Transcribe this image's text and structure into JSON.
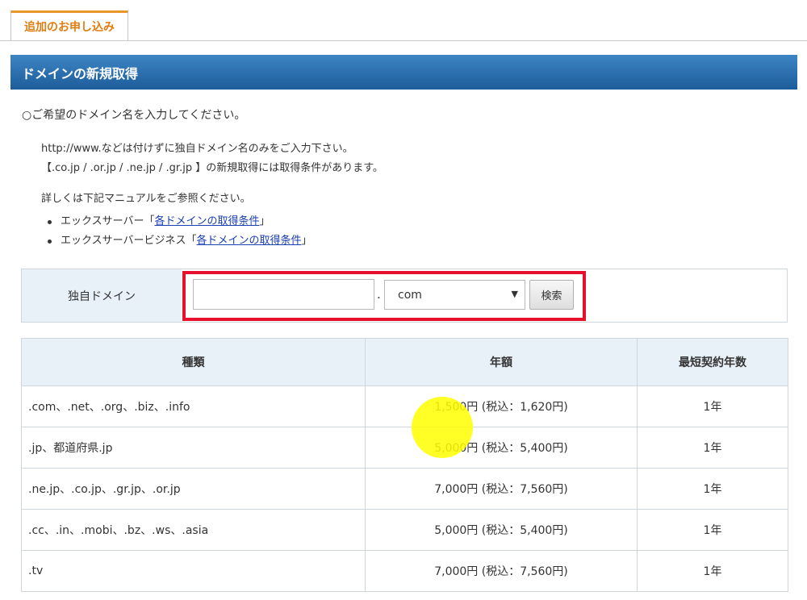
{
  "tab": {
    "label": "追加のお申し込み"
  },
  "section": {
    "title": "ドメインの新規取得"
  },
  "intro": "○ご希望のドメイン名を入力してください。",
  "notes": {
    "line1": "http://www.などは付けずに独自ドメイン名のみをご入力下さい。",
    "line2": "【.co.jp / .or.jp / .ne.jp / .gr.jp 】の新規取得には取得条件があります。",
    "line3": "詳しくは下記マニュアルをご参照ください。"
  },
  "manual_links": [
    {
      "prefix": "エックスサーバー「",
      "link": "各ドメインの取得条件",
      "suffix": "」"
    },
    {
      "prefix": "エックスサーバービジネス「",
      "link": "各ドメインの取得条件",
      "suffix": "」"
    }
  ],
  "search": {
    "label": "独自ドメイン",
    "input_value": "",
    "dot": ".",
    "tld_selected": "com",
    "button_label": "検索"
  },
  "table": {
    "headers": [
      "種類",
      "年額",
      "最短契約年数"
    ],
    "rows": [
      {
        "type": ".com、.net、.org、.biz、.info",
        "price": "1,500円 (税込：1,620円)",
        "term": "1年"
      },
      {
        "type": ".jp、都道府県.jp",
        "price": "5,000円 (税込：5,400円)",
        "term": "1年"
      },
      {
        "type": ".ne.jp、.co.jp、.gr.jp、.or.jp",
        "price": "7,000円 (税込：7,560円)",
        "term": "1年"
      },
      {
        "type": ".cc、.in、.mobi、.bz、.ws、.asia",
        "price": "5,000円 (税込：5,400円)",
        "term": "1年"
      },
      {
        "type": ".tv",
        "price": "7,000円 (税込：7,560円)",
        "term": "1年"
      }
    ]
  },
  "colors": {
    "tab_accent": "#e07d10",
    "header_blue": "#1d5c9a",
    "highlight_red": "#e8112d",
    "link_blue": "#1a3fb0",
    "cursor_yellow": "#ffff00"
  }
}
